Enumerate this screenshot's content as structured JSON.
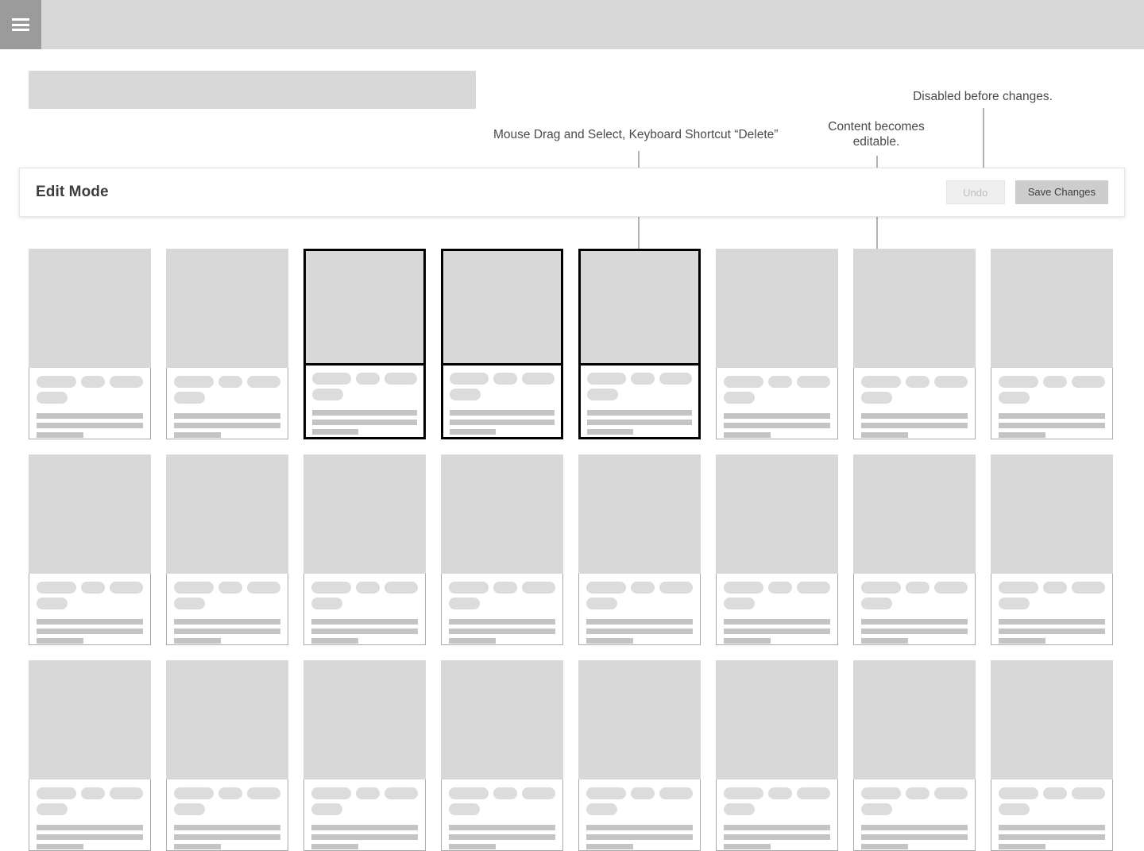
{
  "topbar": {
    "menu_icon": "hamburger-menu-icon"
  },
  "annotations": [
    {
      "id": "select-note",
      "text": "Mouse Drag and Select, Keyboard Shortcut “Delete”"
    },
    {
      "id": "editable-note",
      "text": "Content becomes\neditable."
    },
    {
      "id": "disabled-note",
      "text": "Disabled before changes."
    }
  ],
  "editbar": {
    "title": "Edit Mode",
    "undo_label": "Undo",
    "undo_disabled": true,
    "save_label": "Save Changes"
  },
  "colors": {
    "topbar_bg": "#d8d8d8",
    "menu_button_bg": "#9b9b9b",
    "placeholder_gray": "#d8d8d8",
    "selection_border": "#000000",
    "save_button_bg": "#cdcdcd",
    "undo_button_bg": "#efefef",
    "annotation_text": "#4a4a4a",
    "connector_line": "#b3b3b3"
  },
  "grid": {
    "columns": 8,
    "cards": [
      {
        "index": 0,
        "selected": false,
        "row": 1
      },
      {
        "index": 1,
        "selected": false,
        "row": 1
      },
      {
        "index": 2,
        "selected": true,
        "row": 1
      },
      {
        "index": 3,
        "selected": true,
        "row": 1
      },
      {
        "index": 4,
        "selected": true,
        "row": 1
      },
      {
        "index": 5,
        "selected": false,
        "row": 1
      },
      {
        "index": 6,
        "selected": false,
        "row": 1
      },
      {
        "index": 7,
        "selected": false,
        "row": 1
      },
      {
        "index": 8,
        "selected": false,
        "row": 2
      },
      {
        "index": 9,
        "selected": false,
        "row": 2
      },
      {
        "index": 10,
        "selected": false,
        "row": 2
      },
      {
        "index": 11,
        "selected": false,
        "row": 2
      },
      {
        "index": 12,
        "selected": false,
        "row": 2
      },
      {
        "index": 13,
        "selected": false,
        "row": 2
      },
      {
        "index": 14,
        "selected": false,
        "row": 2
      },
      {
        "index": 15,
        "selected": false,
        "row": 2
      },
      {
        "index": 16,
        "selected": false,
        "row": 3
      },
      {
        "index": 17,
        "selected": false,
        "row": 3
      },
      {
        "index": 18,
        "selected": false,
        "row": 3
      },
      {
        "index": 19,
        "selected": false,
        "row": 3
      },
      {
        "index": 20,
        "selected": false,
        "row": 3
      },
      {
        "index": 21,
        "selected": false,
        "row": 3
      },
      {
        "index": 22,
        "selected": false,
        "row": 3
      },
      {
        "index": 23,
        "selected": false,
        "row": 3
      }
    ]
  }
}
